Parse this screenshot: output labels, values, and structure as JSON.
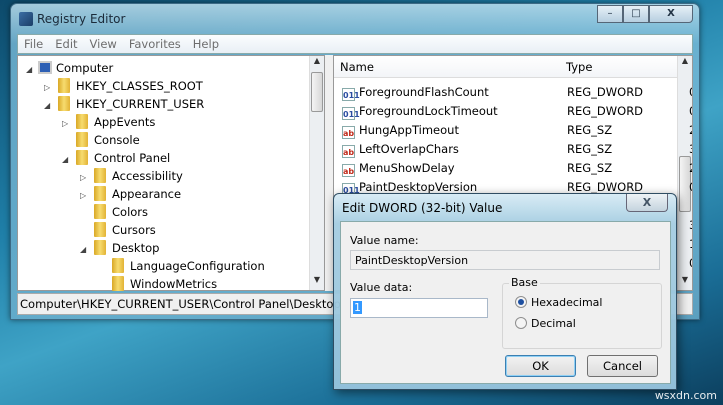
{
  "window": {
    "title": "Registry Editor",
    "minimize": "–",
    "maximize": "□",
    "close": "X"
  },
  "menu": [
    "File",
    "Edit",
    "View",
    "Favorites",
    "Help"
  ],
  "tree": [
    {
      "label": "Computer",
      "expander": "◢",
      "level": 0,
      "icon": "computer"
    },
    {
      "label": "HKEY_CLASSES_ROOT",
      "expander": "▷",
      "level": 1
    },
    {
      "label": "HKEY_CURRENT_USER",
      "expander": "◢",
      "level": 1
    },
    {
      "label": "AppEvents",
      "expander": "▷",
      "level": 2
    },
    {
      "label": "Console",
      "expander": "",
      "level": 2
    },
    {
      "label": "Control Panel",
      "expander": "◢",
      "level": 2
    },
    {
      "label": "Accessibility",
      "expander": "▷",
      "level": 3
    },
    {
      "label": "Appearance",
      "expander": "▷",
      "level": 3
    },
    {
      "label": "Colors",
      "expander": "",
      "level": 3
    },
    {
      "label": "Cursors",
      "expander": "",
      "level": 3
    },
    {
      "label": "Desktop",
      "expander": "◢",
      "level": 3
    },
    {
      "label": "LanguageConfiguration",
      "expander": "",
      "level": 4
    },
    {
      "label": "WindowMetrics",
      "expander": "",
      "level": 4
    }
  ],
  "list": {
    "columns": [
      "Name",
      "Type",
      "D"
    ],
    "rows": [
      {
        "name": "ForegroundFlashCount",
        "type": "REG_DWORD",
        "data": "0",
        "icon": "bin",
        "iconText": "011"
      },
      {
        "name": "ForegroundLockTimeout",
        "type": "REG_DWORD",
        "data": "0",
        "icon": "bin",
        "iconText": "011"
      },
      {
        "name": "HungAppTimeout",
        "type": "REG_SZ",
        "data": "2",
        "icon": "ab",
        "iconText": "ab"
      },
      {
        "name": "LeftOverlapChars",
        "type": "REG_SZ",
        "data": "3",
        "icon": "ab",
        "iconText": "ab"
      },
      {
        "name": "MenuShowDelay",
        "type": "REG_SZ",
        "data": "2",
        "icon": "ab",
        "iconText": "ab"
      },
      {
        "name": "PaintDesktopVersion",
        "type": "REG_DWORD",
        "data": "0",
        "icon": "bin",
        "iconText": "011"
      }
    ],
    "hidden_data": [
      "3",
      "1",
      "0"
    ]
  },
  "status": "Computer\\HKEY_CURRENT_USER\\Control Panel\\Desktop",
  "dialog": {
    "title": "Edit DWORD (32-bit) Value",
    "close": "X",
    "value_name_label": "Value name:",
    "value_name": "PaintDesktopVersion",
    "value_data_label": "Value data:",
    "value_data": "1",
    "base_label": "Base",
    "hex_label": "Hexadecimal",
    "dec_label": "Decimal",
    "selected_base": "Hexadecimal",
    "ok": "OK",
    "cancel": "Cancel"
  },
  "watermark": "wsxdn.com"
}
